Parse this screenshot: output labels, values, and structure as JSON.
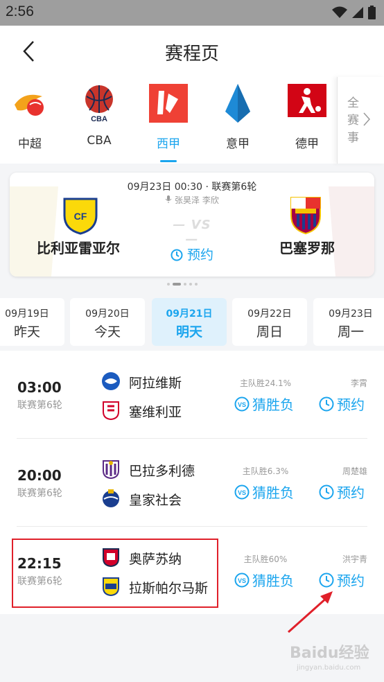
{
  "status_bar": {
    "time": "2:56"
  },
  "header": {
    "title": "赛程页"
  },
  "leagues": [
    {
      "name": "中超"
    },
    {
      "name": "CBA"
    },
    {
      "name": "西甲",
      "active": true
    },
    {
      "name": "意甲"
    },
    {
      "name": "德甲"
    }
  ],
  "more": {
    "label": "全赛事"
  },
  "featured": {
    "meta": "09月23日 00:30 · 联赛第6轮",
    "commentators": "张昊泽 李欣",
    "home": "比利亚雷亚尔",
    "away": "巴塞罗那",
    "vs": "— VS —",
    "reserve_label": "预约"
  },
  "dates": [
    {
      "date": "09月19日",
      "day": "昨天"
    },
    {
      "date": "09月20日",
      "day": "今天"
    },
    {
      "date": "09月21日",
      "day": "明天",
      "active": true
    },
    {
      "date": "09月22日",
      "day": "周日"
    },
    {
      "date": "09月23日",
      "day": "周一"
    }
  ],
  "matches": [
    {
      "time": "03:00",
      "round": "联赛第6轮",
      "home": "阿拉维斯",
      "away": "塞维利亚",
      "prob": "主队胜24.1%",
      "host": "李霄",
      "guess_label": "猜胜负",
      "reserve_label": "预约"
    },
    {
      "time": "20:00",
      "round": "联赛第6轮",
      "home": "巴拉多利德",
      "away": "皇家社会",
      "prob": "主队胜6.3%",
      "host": "周楚雄",
      "guess_label": "猜胜负",
      "reserve_label": "预约"
    },
    {
      "time": "22:15",
      "round": "联赛第6轮",
      "home": "奥萨苏纳",
      "away": "拉斯帕尔马斯",
      "prob": "主队胜60%",
      "host": "洪宇青",
      "guess_label": "猜胜负",
      "reserve_label": "预约"
    }
  ],
  "watermark": {
    "text": "Baidu经验",
    "sub": "jingyan.baidu.com"
  },
  "colors": {
    "accent": "#1ba5ee",
    "highlight": "#e0202a"
  }
}
